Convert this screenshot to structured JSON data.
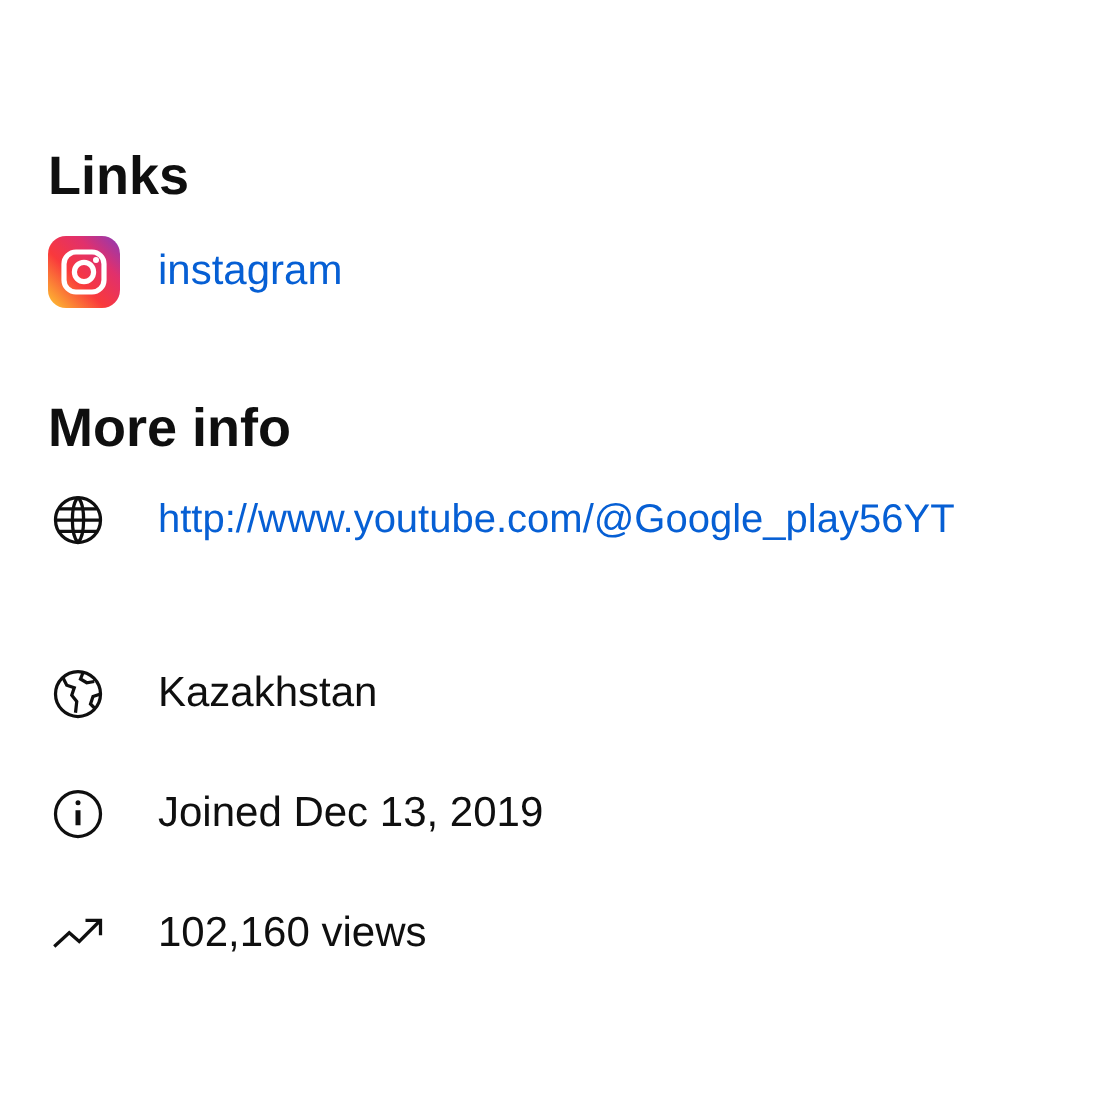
{
  "links": {
    "heading": "Links",
    "items": [
      {
        "kind": "instagram",
        "label": "instagram"
      }
    ]
  },
  "more_info": {
    "heading": "More info",
    "items": [
      {
        "kind": "website",
        "text": "http://www.youtube.com/@Google_play56YT"
      },
      {
        "kind": "location",
        "text": "Kazakhstan"
      },
      {
        "kind": "joined",
        "text": "Joined Dec 13, 2019"
      },
      {
        "kind": "views",
        "text": "102,160 views"
      }
    ]
  }
}
